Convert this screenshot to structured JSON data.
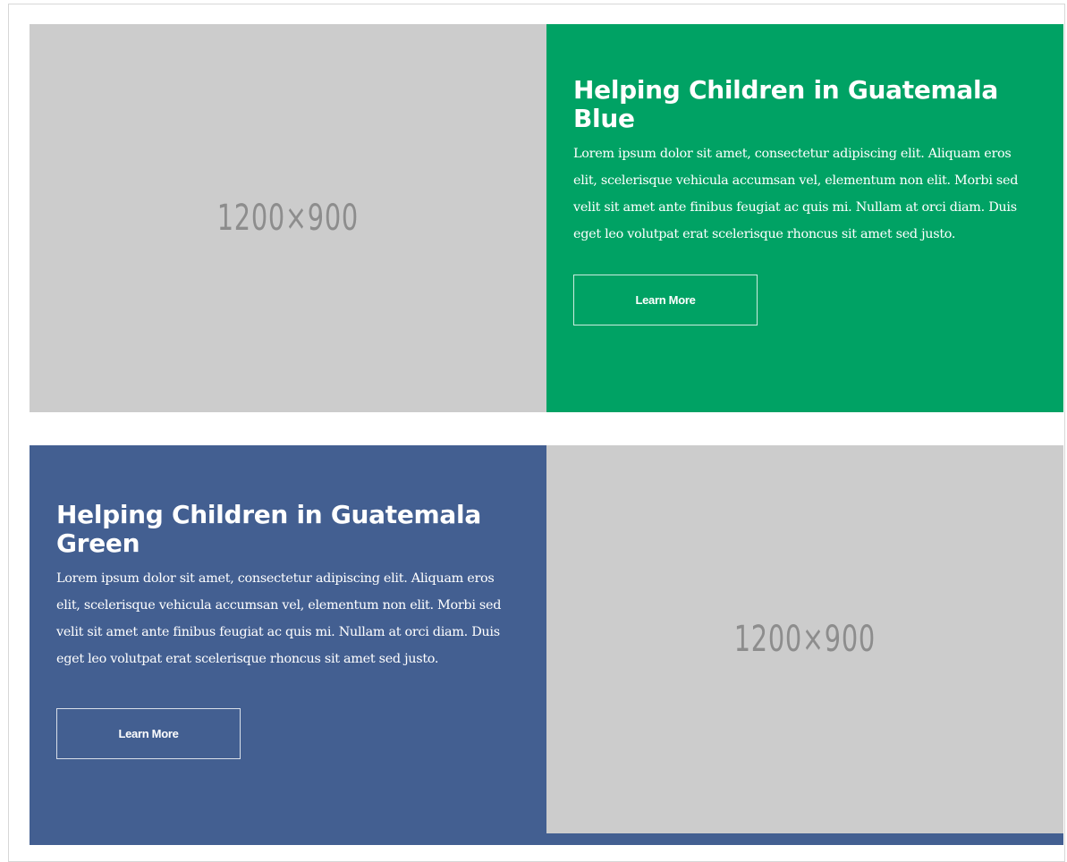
{
  "rows": [
    {
      "placeholder": "1200×900",
      "heading": "Helping Children in Guatemala Blue",
      "body": "Lorem ipsum dolor sit amet, consectetur adipiscing elit. Aliquam eros elit, scelerisque vehicula accumsan vel, elementum non elit. Morbi sed velit sit amet ante finibus feugiat ac quis mi. Nullam at orci diam. Duis eget leo volutpat erat scelerisque rhoncus sit amet sed justo.",
      "button": "Learn More",
      "color": "#00a264"
    },
    {
      "placeholder": "1200×900",
      "heading": "Helping Children in Guatemala Green",
      "body": "Lorem ipsum dolor sit amet, consectetur adipiscing elit. Aliquam eros elit, scelerisque vehicula accumsan vel, elementum non elit. Morbi sed velit sit amet ante finibus feugiat ac quis mi. Nullam at orci diam. Duis eget leo volutpat erat scelerisque rhoncus sit amet sed justo.",
      "button": "Learn More",
      "color": "#435f91"
    }
  ]
}
